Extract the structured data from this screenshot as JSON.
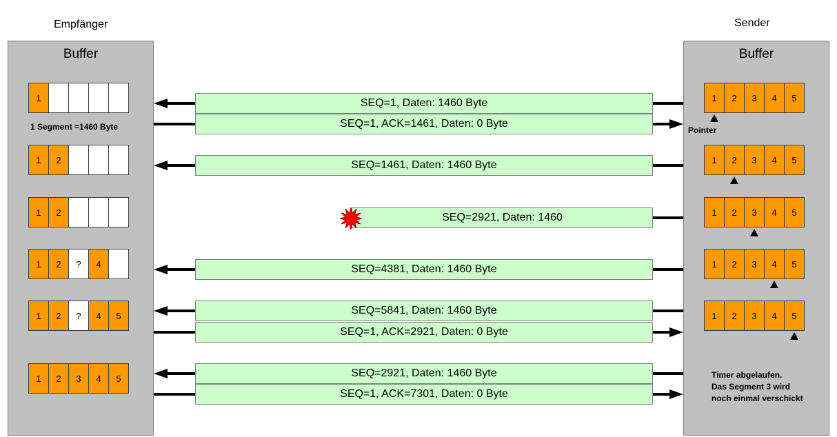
{
  "receiver": {
    "label": "Empfänger",
    "buffer_title": "Buffer",
    "segment_note": "1 Segment =1460 Byte",
    "rows": [
      [
        {
          "t": "1",
          "f": true
        },
        {
          "t": "",
          "f": false
        },
        {
          "t": "",
          "f": false
        },
        {
          "t": "",
          "f": false
        },
        {
          "t": "",
          "f": false
        }
      ],
      [
        {
          "t": "1",
          "f": true
        },
        {
          "t": "2",
          "f": true
        },
        {
          "t": "",
          "f": false
        },
        {
          "t": "",
          "f": false
        },
        {
          "t": "",
          "f": false
        }
      ],
      [
        {
          "t": "1",
          "f": true
        },
        {
          "t": "2",
          "f": true
        },
        {
          "t": "",
          "f": false
        },
        {
          "t": "",
          "f": false
        },
        {
          "t": "",
          "f": false
        }
      ],
      [
        {
          "t": "1",
          "f": true
        },
        {
          "t": "2",
          "f": true
        },
        {
          "t": "?",
          "f": false
        },
        {
          "t": "4",
          "f": true
        },
        {
          "t": "",
          "f": false
        }
      ],
      [
        {
          "t": "1",
          "f": true
        },
        {
          "t": "2",
          "f": true
        },
        {
          "t": "?",
          "f": false
        },
        {
          "t": "4",
          "f": true
        },
        {
          "t": "5",
          "f": true
        }
      ],
      [
        {
          "t": "1",
          "f": true
        },
        {
          "t": "2",
          "f": true
        },
        {
          "t": "3",
          "f": true
        },
        {
          "t": "4",
          "f": true
        },
        {
          "t": "5",
          "f": true
        }
      ]
    ]
  },
  "sender": {
    "label": "Sender",
    "buffer_title": "Buffer",
    "segments": [
      "1",
      "2",
      "3",
      "4",
      "5"
    ],
    "pointer_label": "Pointer",
    "pointer_positions": [
      1,
      2,
      3,
      4,
      5
    ],
    "timer_note": [
      "Timer abgelaufen.",
      "Das Segment 3 wird",
      "noch einmal verschickt"
    ]
  },
  "messages": [
    {
      "text": "SEQ=1,  Daten: 1460 Byte",
      "direction": "to_receiver"
    },
    {
      "text": "SEQ=1, ACK=1461, Daten: 0 Byte",
      "direction": "to_sender"
    },
    {
      "text": "SEQ=1461, Daten: 1460 Byte",
      "direction": "to_receiver"
    },
    {
      "text": "SEQ=2921, Daten: 1460",
      "direction": "lost"
    },
    {
      "text": "SEQ=4381, Daten: 1460 Byte",
      "direction": "to_receiver"
    },
    {
      "text": "SEQ=5841, Daten: 1460 Byte",
      "direction": "to_receiver"
    },
    {
      "text": "SEQ=1, ACK=2921, Daten: 0 Byte",
      "direction": "to_sender"
    },
    {
      "text": "SEQ=2921, Daten: 1460 Byte",
      "direction": "to_receiver"
    },
    {
      "text": "SEQ=1, ACK=7301, Daten: 0 Byte",
      "direction": "to_sender"
    }
  ],
  "colors": {
    "segment_filled": "#ff9900",
    "segment_empty": "#ffffff",
    "message_bg": "#ccffcc",
    "buffer_bg": "#c0c0c0",
    "lost_marker": "#ff0000"
  }
}
